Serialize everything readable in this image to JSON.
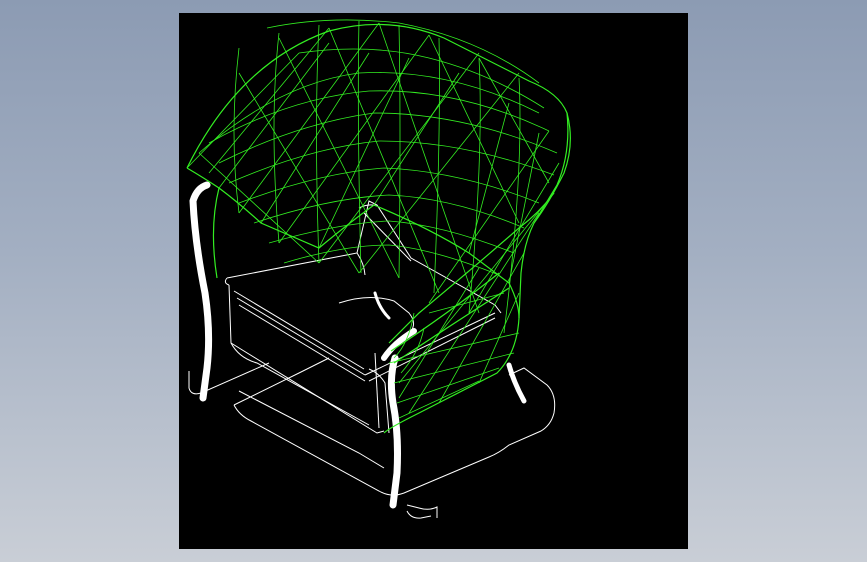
{
  "colors": {
    "background_top": "#8c9bb3",
    "background_bottom": "#c9ced6",
    "viewport": "#000000",
    "wireframe_shell": "#33ee22",
    "wireframe_frame": "#ffffff"
  },
  "scene": {
    "object": "armchair-wireframe",
    "view": "isometric",
    "render_mode": "wireframe"
  }
}
